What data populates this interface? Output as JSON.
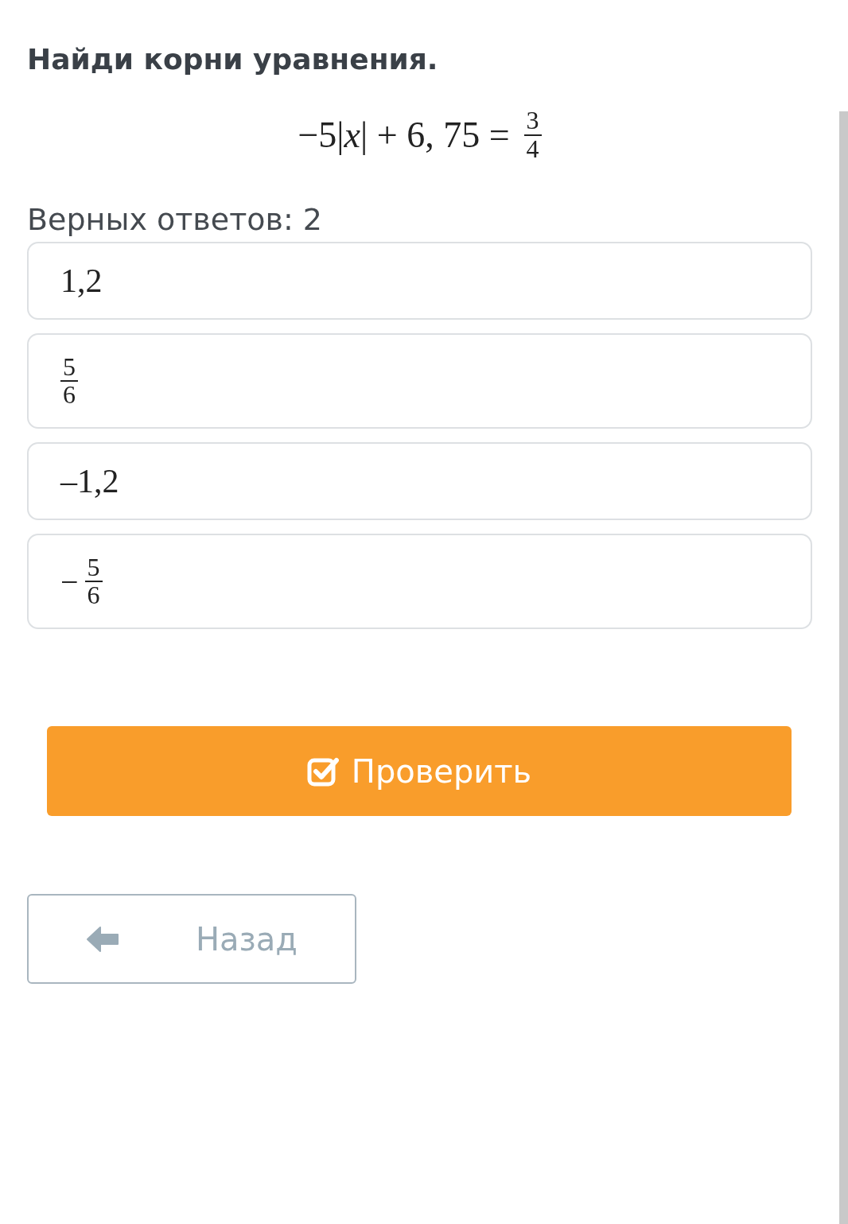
{
  "title": "Найди корни уравнения.",
  "equation": {
    "left": "−5|*x*| + 6, 75 =",
    "numerator": "3",
    "denominator": "4"
  },
  "answers_count": "Верных ответов: 2",
  "options": [
    {
      "kind": "text",
      "text": "1,2",
      "selected": false
    },
    {
      "kind": "fraction",
      "numerator": "5",
      "denominator": "6",
      "selected": false
    },
    {
      "kind": "text",
      "text": "–1,2",
      "selected": false
    },
    {
      "kind": "fraction",
      "sign": "−",
      "numerator": "5",
      "denominator": "6",
      "selected": false
    }
  ],
  "check_button": {
    "label": "Проверить"
  },
  "back_button": {
    "label": "Назад"
  }
}
